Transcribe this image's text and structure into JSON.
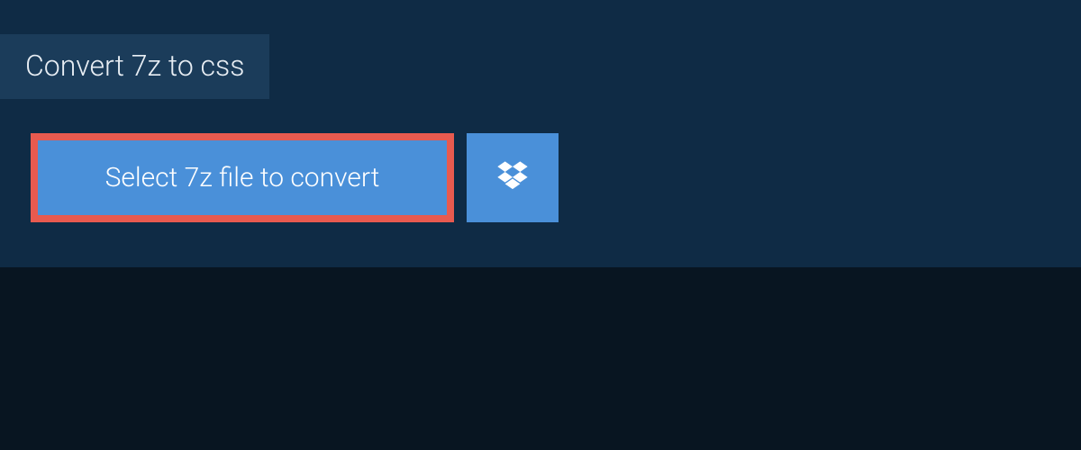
{
  "tab": {
    "title": "Convert 7z to css"
  },
  "actions": {
    "select_label": "Select 7z file to convert",
    "dropbox_icon": "dropbox"
  },
  "colors": {
    "bg_outer": "#081521",
    "bg_panel": "#0f2b45",
    "bg_tab": "#1b3c5a",
    "button_fill": "#4a90d9",
    "button_border": "#e85a4f"
  }
}
